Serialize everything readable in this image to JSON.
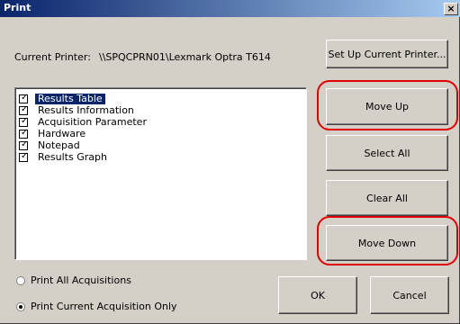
{
  "window": {
    "title": "Print",
    "close_glyph": "×"
  },
  "printer": {
    "label": "Current Printer:",
    "name": "\\\\SPQCPRN01\\Lexmark Optra T614"
  },
  "buttons": {
    "setup_printer": "Set Up Current Printer...",
    "move_up": "Move Up",
    "select_all": "Select All",
    "clear_all": "Clear All",
    "move_down": "Move Down",
    "ok": "OK",
    "cancel": "Cancel"
  },
  "report_items": [
    {
      "label": "Results Table",
      "checked": true,
      "selected": true
    },
    {
      "label": "Results Information",
      "checked": true,
      "selected": false
    },
    {
      "label": "Acquisition Parameter",
      "checked": true,
      "selected": false
    },
    {
      "label": "Hardware",
      "checked": true,
      "selected": false
    },
    {
      "label": "Notepad",
      "checked": true,
      "selected": false
    },
    {
      "label": "Results Graph",
      "checked": true,
      "selected": false
    }
  ],
  "print_scope": {
    "options": [
      {
        "label": "Print All Acquisitions",
        "checked": false
      },
      {
        "label": "Print Current Acquisition Only",
        "checked": true
      }
    ]
  },
  "colors": {
    "title_bar": "#0a246a",
    "dialog_background": "#d4d0c8",
    "selection": "#0a246a",
    "highlight_annotation": "#e00000"
  }
}
